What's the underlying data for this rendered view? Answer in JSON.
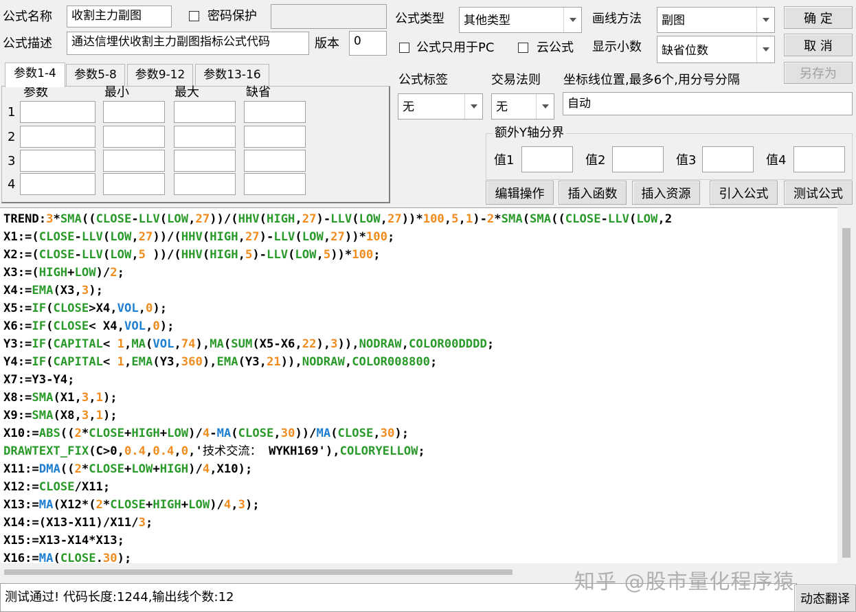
{
  "header": {
    "name_label": "公式名称",
    "name_value": "收割主力副图",
    "password_label": "密码保护",
    "desc_label": "公式描述",
    "desc_value": "通达信埋伏收割主力副图指标公式代码",
    "version_label": "版本",
    "version_value": "0",
    "type_label": "公式类型",
    "type_value": "其他类型",
    "draw_label": "画线方法",
    "draw_value": "副图",
    "pc_only_label": "公式只用于PC",
    "cloud_label": "云公式",
    "decimal_label": "显示小数",
    "decimal_value": "缺省位数"
  },
  "buttons": {
    "ok": "确 定",
    "cancel": "取 消",
    "save_as": "另存为",
    "edit_ops": "编辑操作",
    "insert_func": "插入函数",
    "insert_res": "插入资源",
    "import_formula": "引入公式",
    "test_formula": "测试公式",
    "dynamic_translate": "动态翻译"
  },
  "params": {
    "tabs": [
      "参数1-4",
      "参数5-8",
      "参数9-12",
      "参数13-16"
    ],
    "headers": [
      "参数",
      "最小",
      "最大",
      "缺省"
    ],
    "rows": [
      "1",
      "2",
      "3",
      "4"
    ]
  },
  "options": {
    "tag_label": "公式标签",
    "tag_value": "无",
    "rule_label": "交易法则",
    "rule_value": "无",
    "axis_label": "坐标线位置,最多6个,用分号分隔",
    "axis_value": "自动",
    "extra_label": "额外Y轴分界",
    "v1": "值1",
    "v2": "值2",
    "v3": "值3",
    "v4": "值4"
  },
  "code_lines": [
    [
      [
        "TREND:",
        "d"
      ],
      [
        "3",
        "n"
      ],
      [
        "*",
        "d"
      ],
      [
        "SMA",
        "k"
      ],
      [
        "((",
        "d"
      ],
      [
        "CLOSE",
        "k"
      ],
      [
        "-",
        "d"
      ],
      [
        "LLV",
        "k"
      ],
      [
        "(",
        "d"
      ],
      [
        "LOW",
        "k"
      ],
      [
        ",",
        "d"
      ],
      [
        "27",
        "n"
      ],
      [
        "))/(",
        "d"
      ],
      [
        "HHV",
        "k"
      ],
      [
        "(",
        "d"
      ],
      [
        "HIGH",
        "k"
      ],
      [
        ",",
        "d"
      ],
      [
        "27",
        "n"
      ],
      [
        ")-",
        "d"
      ],
      [
        "LLV",
        "k"
      ],
      [
        "(",
        "d"
      ],
      [
        "LOW",
        "k"
      ],
      [
        ",",
        "d"
      ],
      [
        "27",
        "n"
      ],
      [
        "))*",
        "d"
      ],
      [
        "100",
        "n"
      ],
      [
        ",",
        "d"
      ],
      [
        "5",
        "n"
      ],
      [
        ",",
        "d"
      ],
      [
        "1",
        "n"
      ],
      [
        ")-",
        "d"
      ],
      [
        "2",
        "n"
      ],
      [
        "*",
        "d"
      ],
      [
        "SMA",
        "k"
      ],
      [
        "(",
        "d"
      ],
      [
        "SMA",
        "k"
      ],
      [
        "((",
        "d"
      ],
      [
        "CLOSE",
        "k"
      ],
      [
        "-",
        "d"
      ],
      [
        "LLV",
        "k"
      ],
      [
        "(",
        "d"
      ],
      [
        "LOW",
        "k"
      ],
      [
        ",2",
        "d"
      ]
    ],
    [
      [
        "X1:=(",
        "d"
      ],
      [
        "CLOSE",
        "k"
      ],
      [
        "-",
        "d"
      ],
      [
        "LLV",
        "k"
      ],
      [
        "(",
        "d"
      ],
      [
        "LOW",
        "k"
      ],
      [
        ",",
        "d"
      ],
      [
        "27",
        "n"
      ],
      [
        "))/(",
        "d"
      ],
      [
        "HHV",
        "k"
      ],
      [
        "(",
        "d"
      ],
      [
        "HIGH",
        "k"
      ],
      [
        ",",
        "d"
      ],
      [
        "27",
        "n"
      ],
      [
        ")-",
        "d"
      ],
      [
        "LLV",
        "k"
      ],
      [
        "(",
        "d"
      ],
      [
        "LOW",
        "k"
      ],
      [
        ",",
        "d"
      ],
      [
        "27",
        "n"
      ],
      [
        "))*",
        "d"
      ],
      [
        "100",
        "n"
      ],
      [
        ";",
        "d"
      ]
    ],
    [
      [
        "X2:=(",
        "d"
      ],
      [
        "CLOSE",
        "k"
      ],
      [
        "-",
        "d"
      ],
      [
        "LLV",
        "k"
      ],
      [
        "(",
        "d"
      ],
      [
        "LOW",
        "k"
      ],
      [
        ",",
        "d"
      ],
      [
        "5",
        "n"
      ],
      [
        " ))/(",
        "d"
      ],
      [
        "HHV",
        "k"
      ],
      [
        "(",
        "d"
      ],
      [
        "HIGH",
        "k"
      ],
      [
        ",",
        "d"
      ],
      [
        "5",
        "n"
      ],
      [
        ")-",
        "d"
      ],
      [
        "LLV",
        "k"
      ],
      [
        "(",
        "d"
      ],
      [
        "LOW",
        "k"
      ],
      [
        ",",
        "d"
      ],
      [
        "5",
        "n"
      ],
      [
        "))*",
        "d"
      ],
      [
        "100",
        "n"
      ],
      [
        ";",
        "d"
      ]
    ],
    [
      [
        "X3:=(",
        "d"
      ],
      [
        "HIGH",
        "k"
      ],
      [
        "+",
        "d"
      ],
      [
        "LOW",
        "k"
      ],
      [
        ")/",
        "d"
      ],
      [
        "2",
        "n"
      ],
      [
        ";",
        "d"
      ]
    ],
    [
      [
        "X4:=",
        "d"
      ],
      [
        "EMA",
        "k"
      ],
      [
        "(X3,",
        "d"
      ],
      [
        "3",
        "n"
      ],
      [
        ");",
        "d"
      ]
    ],
    [
      [
        "X5:=",
        "d"
      ],
      [
        "IF",
        "k"
      ],
      [
        "(",
        "d"
      ],
      [
        "CLOSE",
        "k"
      ],
      [
        ">X4,",
        "d"
      ],
      [
        "VOL",
        "f"
      ],
      [
        ",",
        "d"
      ],
      [
        "0",
        "n"
      ],
      [
        ");",
        "d"
      ]
    ],
    [
      [
        "X6:=",
        "d"
      ],
      [
        "IF",
        "k"
      ],
      [
        "(",
        "d"
      ],
      [
        "CLOSE",
        "k"
      ],
      [
        "< X4,",
        "d"
      ],
      [
        "VOL",
        "f"
      ],
      [
        ",",
        "d"
      ],
      [
        "0",
        "n"
      ],
      [
        ");",
        "d"
      ]
    ],
    [
      [
        "Y3:=",
        "d"
      ],
      [
        "IF",
        "k"
      ],
      [
        "(",
        "d"
      ],
      [
        "CAPITAL",
        "k"
      ],
      [
        "< ",
        "d"
      ],
      [
        "1",
        "n"
      ],
      [
        ",",
        "d"
      ],
      [
        "MA",
        "k"
      ],
      [
        "(",
        "d"
      ],
      [
        "VOL",
        "f"
      ],
      [
        ",",
        "d"
      ],
      [
        "74",
        "n"
      ],
      [
        "),",
        "d"
      ],
      [
        "MA",
        "k"
      ],
      [
        "(",
        "d"
      ],
      [
        "SUM",
        "k"
      ],
      [
        "(X5-X6,",
        "d"
      ],
      [
        "22",
        "n"
      ],
      [
        "),",
        "d"
      ],
      [
        "3",
        "n"
      ],
      [
        ")),",
        "d"
      ],
      [
        "NODRAW",
        "k"
      ],
      [
        ",",
        "d"
      ],
      [
        "COLOR00DDDD",
        "k"
      ],
      [
        ";",
        "d"
      ]
    ],
    [
      [
        "Y4:=",
        "d"
      ],
      [
        "IF",
        "k"
      ],
      [
        "(",
        "d"
      ],
      [
        "CAPITAL",
        "k"
      ],
      [
        "< ",
        "d"
      ],
      [
        "1",
        "n"
      ],
      [
        ",",
        "d"
      ],
      [
        "EMA",
        "k"
      ],
      [
        "(Y3,",
        "d"
      ],
      [
        "360",
        "n"
      ],
      [
        "),",
        "d"
      ],
      [
        "EMA",
        "k"
      ],
      [
        "(Y3,",
        "d"
      ],
      [
        "21",
        "n"
      ],
      [
        ")),",
        "d"
      ],
      [
        "NODRAW",
        "k"
      ],
      [
        ",",
        "d"
      ],
      [
        "COLOR008800",
        "k"
      ],
      [
        ";",
        "d"
      ]
    ],
    [
      [
        "X7:=Y3-Y4;",
        "d"
      ]
    ],
    [
      [
        "X8:=",
        "d"
      ],
      [
        "SMA",
        "k"
      ],
      [
        "(X1,",
        "d"
      ],
      [
        "3",
        "n"
      ],
      [
        ",",
        "d"
      ],
      [
        "1",
        "n"
      ],
      [
        ");",
        "d"
      ]
    ],
    [
      [
        "X9:=",
        "d"
      ],
      [
        "SMA",
        "k"
      ],
      [
        "(X8,",
        "d"
      ],
      [
        "3",
        "n"
      ],
      [
        ",",
        "d"
      ],
      [
        "1",
        "n"
      ],
      [
        ");",
        "d"
      ]
    ],
    [
      [
        "X10:=",
        "d"
      ],
      [
        "ABS",
        "k"
      ],
      [
        "((",
        "d"
      ],
      [
        "2",
        "n"
      ],
      [
        "*",
        "d"
      ],
      [
        "CLOSE",
        "k"
      ],
      [
        "+",
        "d"
      ],
      [
        "HIGH",
        "k"
      ],
      [
        "+",
        "d"
      ],
      [
        "LOW",
        "k"
      ],
      [
        ")/",
        "d"
      ],
      [
        "4",
        "n"
      ],
      [
        "-",
        "d"
      ],
      [
        "MA",
        "f"
      ],
      [
        "(",
        "d"
      ],
      [
        "CLOSE",
        "k"
      ],
      [
        ",",
        "d"
      ],
      [
        "30",
        "n"
      ],
      [
        "))/",
        "d"
      ],
      [
        "MA",
        "f"
      ],
      [
        "(",
        "d"
      ],
      [
        "CLOSE",
        "k"
      ],
      [
        ",",
        "d"
      ],
      [
        "30",
        "n"
      ],
      [
        ");",
        "d"
      ]
    ],
    [
      [
        "DRAWTEXT_FIX",
        "k"
      ],
      [
        "(C>0,",
        "d"
      ],
      [
        "0.4",
        "n"
      ],
      [
        ",",
        "d"
      ],
      [
        "0.4",
        "n"
      ],
      [
        ",",
        "d"
      ],
      [
        "0",
        "n"
      ],
      [
        ",'",
        "d"
      ],
      [
        "技术交流：",
        "cj"
      ],
      [
        " WYKH169'),",
        "d"
      ],
      [
        "COLORYELLOW",
        "k"
      ],
      [
        ";",
        "d"
      ]
    ],
    [
      [
        "X11:=",
        "d"
      ],
      [
        "DMA",
        "f"
      ],
      [
        "((",
        "d"
      ],
      [
        "2",
        "n"
      ],
      [
        "*",
        "d"
      ],
      [
        "CLOSE",
        "k"
      ],
      [
        "+",
        "d"
      ],
      [
        "LOW",
        "k"
      ],
      [
        "+",
        "d"
      ],
      [
        "HIGH",
        "k"
      ],
      [
        ")/",
        "d"
      ],
      [
        "4",
        "n"
      ],
      [
        ",X10);",
        "d"
      ]
    ],
    [
      [
        "X12:=",
        "d"
      ],
      [
        "CLOSE",
        "k"
      ],
      [
        "/X11;",
        "d"
      ]
    ],
    [
      [
        "X13:=",
        "d"
      ],
      [
        "MA",
        "f"
      ],
      [
        "(X12*(",
        "d"
      ],
      [
        "2",
        "n"
      ],
      [
        "*",
        "d"
      ],
      [
        "CLOSE",
        "k"
      ],
      [
        "+",
        "d"
      ],
      [
        "HIGH",
        "k"
      ],
      [
        "+",
        "d"
      ],
      [
        "LOW",
        "k"
      ],
      [
        ")/",
        "d"
      ],
      [
        "4",
        "n"
      ],
      [
        ",",
        "d"
      ],
      [
        "3",
        "n"
      ],
      [
        ");",
        "d"
      ]
    ],
    [
      [
        "X14:=(X13-X11)/X11/",
        "d"
      ],
      [
        "3",
        "n"
      ],
      [
        ";",
        "d"
      ]
    ],
    [
      [
        "X15:=X13-X14*X13;",
        "d"
      ]
    ],
    [
      [
        "X16:=",
        "d"
      ],
      [
        "MA",
        "f"
      ],
      [
        "(",
        "d"
      ],
      [
        "CLOSE",
        "k"
      ],
      [
        ".",
        "d"
      ],
      [
        "30",
        "n"
      ],
      [
        ");",
        "d"
      ]
    ]
  ],
  "status": {
    "text": "测试通过! 代码长度:1244,输出线个数:12"
  },
  "watermark": "知乎 @股市量化程序猿",
  "colors": {
    "keyword": "#2a9a2a",
    "number": "#f08c1e",
    "function": "#1e7fd0"
  }
}
